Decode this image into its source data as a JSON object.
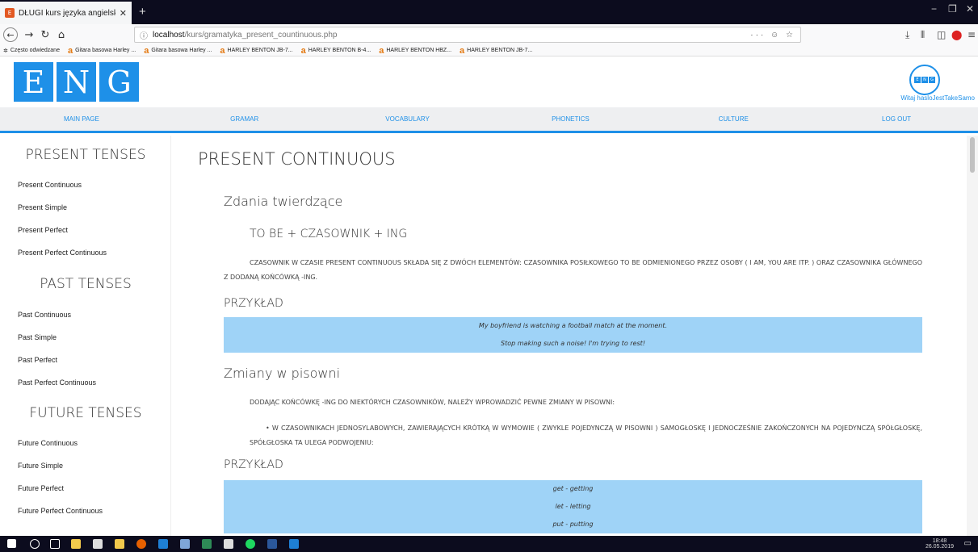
{
  "browser": {
    "tab_title": "DŁUGI kurs języka angielskiego",
    "url_host": "localhost",
    "url_path": "/kurs/gramatyka_present_countinuous.php",
    "url_right_icons": "··· ☺ ☆",
    "bookmarks": [
      "Często odwiedzane",
      "Gitara basowa Harley ...",
      "Gitara basowa Harley ...",
      "HARLEY BENTON JB-7...",
      "HARLEY BENTON B-4...",
      "HARLEY BENTON HBZ...",
      "HARLEY BENTON JB-7..."
    ]
  },
  "site": {
    "logo_letters": [
      "E",
      "N",
      "G"
    ],
    "welcome": "Witaj hasloJestTakeSamo",
    "menu": [
      "MAIN PAGE",
      "GRAMAR",
      "VOCABULARY",
      "PHONETICS",
      "CULTURE",
      "LOG OUT"
    ]
  },
  "sidebar": {
    "sections": [
      {
        "title": "PRESENT TENSES",
        "links": [
          "Present Continuous",
          "Present Simple",
          "Present Perfect",
          "Present Perfect Continuous"
        ]
      },
      {
        "title": "PAST TENSES",
        "links": [
          "Past Continuous",
          "Past Simple",
          "Past Perfect",
          "Past Perfect Continuous"
        ]
      },
      {
        "title": "FUTURE TENSES",
        "links": [
          "Future Continuous",
          "Future Simple",
          "Future Perfect",
          "Future Perfect Continuous"
        ]
      }
    ]
  },
  "content": {
    "title": "PRESENT CONTINUOUS",
    "s1_heading": "Zdania twierdzące",
    "formula": "TO BE + CZASOWNIK + ING",
    "p1": "Czasownik w czasie Present Continuous składa się z dwóch elementów: czasownika posiłkowego to be odmienionego przez osoby ( I am, You are itp. ) oraz czasownika głównego z dodaną końcówką -ing.",
    "example_label_1": "PRZYKŁAD",
    "examples_1": [
      "My boyfriend is watching a football match at the moment.",
      "Stop making such a noise! I'm trying to rest!"
    ],
    "s2_heading": "Zmiany w pisowni",
    "p2": "Dodając końcówkę -ing do niektórych czasowników, należy wprowadzić pewne zmiany w pisowni:",
    "p3": "• W czasownikach jednosylabowych, zawierających krótką w wymowie ( zwykle pojedynczą w pisowni ) samogłoskę i jednocześnie zakończonych na pojedynczą spółgłoskę, spółgłoska ta ulega podwojeniu:",
    "example_label_2": "PRZYKŁAD",
    "examples_2": [
      "get - getting",
      "let - letting",
      "put - putting"
    ]
  },
  "taskbar": {
    "time": "18:48",
    "date": "26.05.2019"
  }
}
